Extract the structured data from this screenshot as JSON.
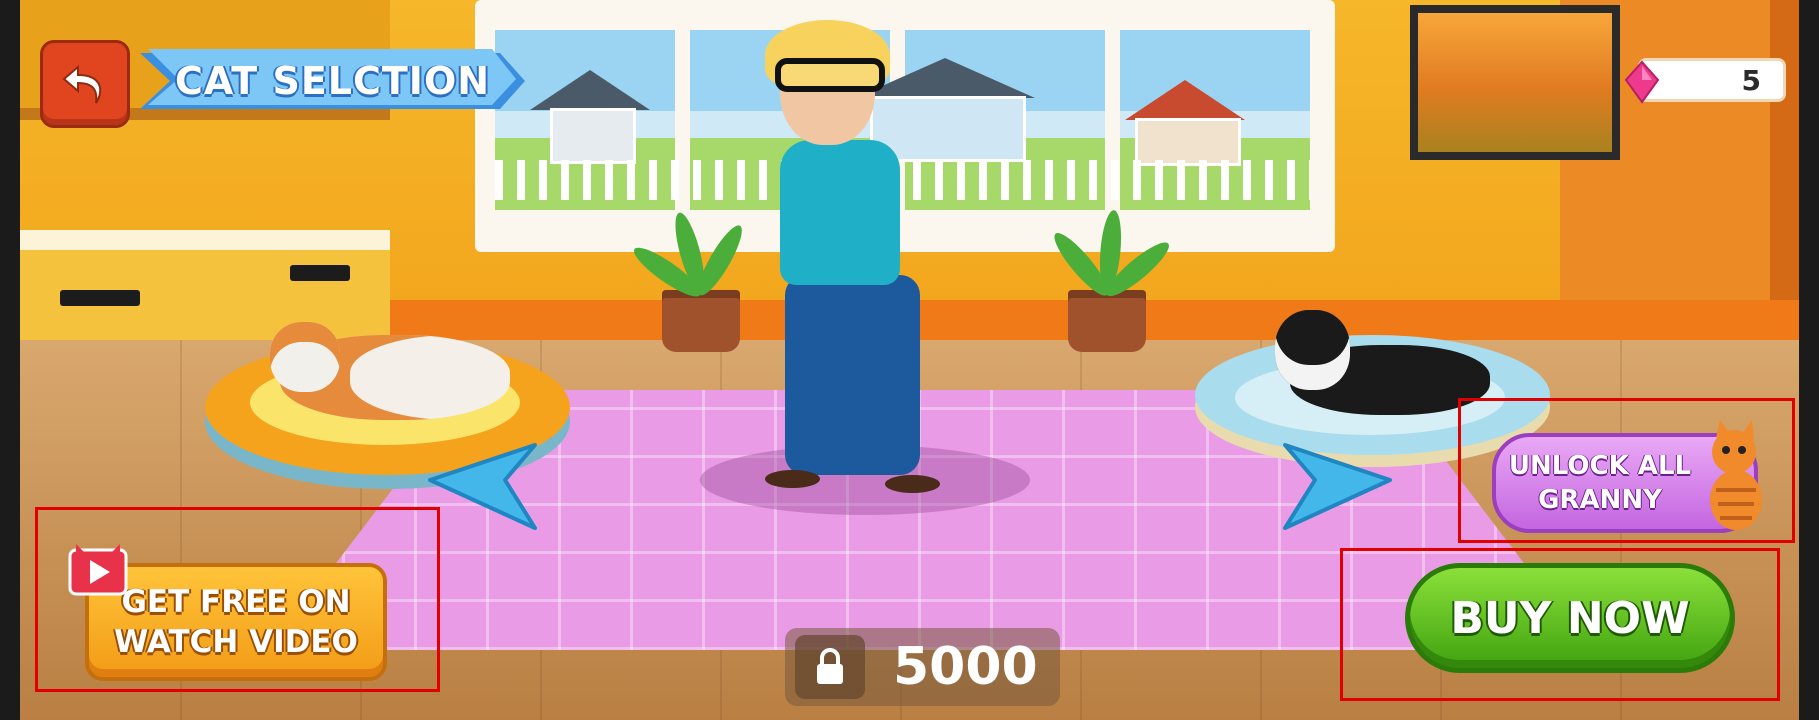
{
  "screen": {
    "title": "CAT SELCTION"
  },
  "currency": {
    "gems": "5",
    "gem_color": "#ee3a8c"
  },
  "actions": {
    "back_icon": "back-arrow-icon",
    "prev_icon": "left-arrow-icon",
    "next_icon": "right-arrow-icon",
    "watch_video_label_line1": "GET FREE ON",
    "watch_video_label_line2": "WATCH VIDEO",
    "unlock_all_line1": "UNLOCK ALL",
    "unlock_all_line2": "GRANNY",
    "buy_now_label": "BUY NOW"
  },
  "price": {
    "lock_icon": "lock-icon",
    "amount": "5000"
  },
  "colors": {
    "buy_green": "#3fa20f",
    "watch_orange": "#f29b16",
    "unlock_purple": "#c466e0",
    "back_red": "#e0451f",
    "banner_blue": "#3a8fe0",
    "highlight_red": "#e00000"
  }
}
